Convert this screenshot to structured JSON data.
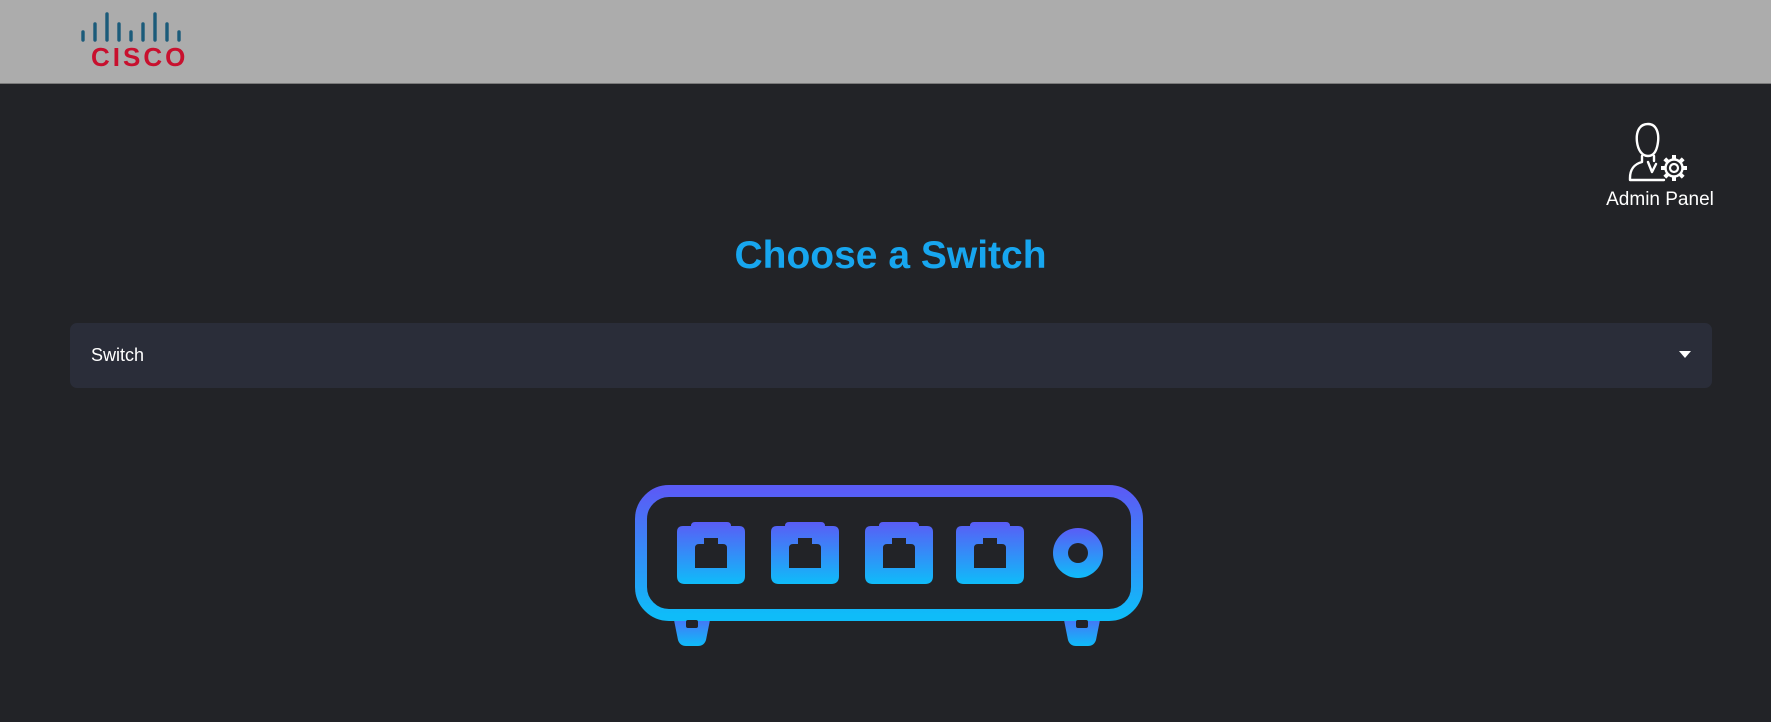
{
  "header": {
    "logo_text": "CISCO",
    "background": "#acacac"
  },
  "admin_panel": {
    "label": "Admin Panel",
    "icon": "admin-user-gear-icon"
  },
  "main": {
    "title": "Choose a Switch",
    "title_color": "#17a6ef",
    "switch_select": {
      "selected_value": "Switch",
      "icon": "chevron-down-icon"
    },
    "illustration": {
      "icon": "network-switch-icon",
      "gradient": [
        "#5a5cf6",
        "#0fbcf9"
      ]
    }
  }
}
